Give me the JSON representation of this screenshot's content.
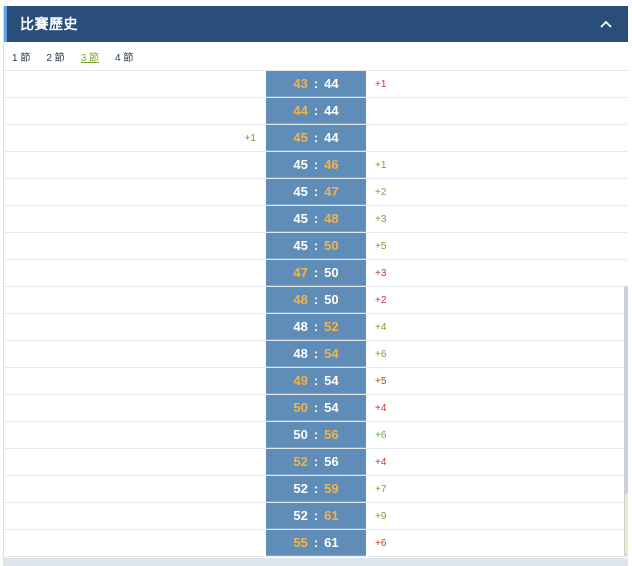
{
  "header": {
    "title": "比賽歷史",
    "collapse_icon": "chevron-up-icon"
  },
  "tabs": [
    {
      "label": "1 節",
      "active": false
    },
    {
      "label": "2 節",
      "active": false
    },
    {
      "label": "3 節",
      "active": true
    },
    {
      "label": "4 節",
      "active": false
    }
  ],
  "colors": {
    "header_bg": "#2a4e7a",
    "score_bg": "#5f8db8",
    "highlight": "#f2b34a",
    "positive": "#6aa830",
    "negative": "#c0392b",
    "active_tab": "#7aa52a"
  },
  "rows": [
    {
      "home": "43",
      "away": "44",
      "hl": "home",
      "left_diff": "",
      "left_tone": "",
      "right_diff": "+1",
      "right_tone": "neg"
    },
    {
      "home": "44",
      "away": "44",
      "hl": "home",
      "left_diff": "",
      "left_tone": "",
      "right_diff": "",
      "right_tone": ""
    },
    {
      "home": "45",
      "away": "44",
      "hl": "home",
      "left_diff": "+1",
      "left_tone": "pos",
      "right_diff": "",
      "right_tone": ""
    },
    {
      "home": "45",
      "away": "46",
      "hl": "away",
      "left_diff": "",
      "left_tone": "",
      "right_diff": "+1",
      "right_tone": "pos"
    },
    {
      "home": "45",
      "away": "47",
      "hl": "away",
      "left_diff": "",
      "left_tone": "",
      "right_diff": "+2",
      "right_tone": "pos"
    },
    {
      "home": "45",
      "away": "48",
      "hl": "away",
      "left_diff": "",
      "left_tone": "",
      "right_diff": "+3",
      "right_tone": "pos"
    },
    {
      "home": "45",
      "away": "50",
      "hl": "away",
      "left_diff": "",
      "left_tone": "",
      "right_diff": "+5",
      "right_tone": "pos"
    },
    {
      "home": "47",
      "away": "50",
      "hl": "home",
      "left_diff": "",
      "left_tone": "",
      "right_diff": "+3",
      "right_tone": "neg"
    },
    {
      "home": "48",
      "away": "50",
      "hl": "home",
      "left_diff": "",
      "left_tone": "",
      "right_diff": "+2",
      "right_tone": "neg"
    },
    {
      "home": "48",
      "away": "52",
      "hl": "away",
      "left_diff": "",
      "left_tone": "",
      "right_diff": "+4",
      "right_tone": "pos"
    },
    {
      "home": "48",
      "away": "54",
      "hl": "away",
      "left_diff": "",
      "left_tone": "",
      "right_diff": "+6",
      "right_tone": "pos"
    },
    {
      "home": "49",
      "away": "54",
      "hl": "home",
      "left_diff": "",
      "left_tone": "",
      "right_diff": "+5",
      "right_tone": "neg"
    },
    {
      "home": "50",
      "away": "54",
      "hl": "home",
      "left_diff": "",
      "left_tone": "",
      "right_diff": "+4",
      "right_tone": "neg"
    },
    {
      "home": "50",
      "away": "56",
      "hl": "away",
      "left_diff": "",
      "left_tone": "",
      "right_diff": "+6",
      "right_tone": "pos"
    },
    {
      "home": "52",
      "away": "56",
      "hl": "home",
      "left_diff": "",
      "left_tone": "",
      "right_diff": "+4",
      "right_tone": "neg"
    },
    {
      "home": "52",
      "away": "59",
      "hl": "away",
      "left_diff": "",
      "left_tone": "",
      "right_diff": "+7",
      "right_tone": "pos"
    },
    {
      "home": "52",
      "away": "61",
      "hl": "away",
      "left_diff": "",
      "left_tone": "",
      "right_diff": "+9",
      "right_tone": "pos"
    },
    {
      "home": "55",
      "away": "61",
      "hl": "home",
      "left_diff": "",
      "left_tone": "",
      "right_diff": "+6",
      "right_tone": "neg"
    }
  ]
}
